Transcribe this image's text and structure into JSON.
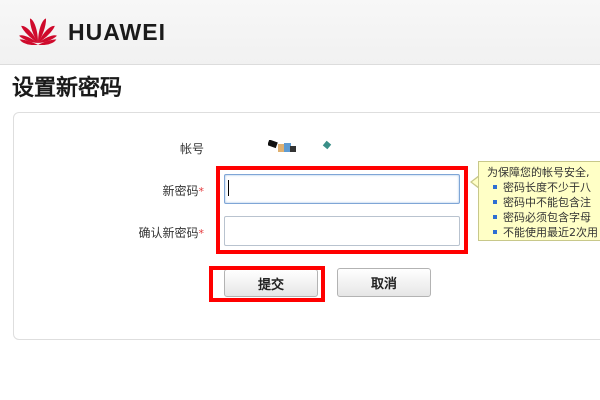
{
  "header": {
    "brand_name": "HUAWEI",
    "brand_color": "#cf0a2c"
  },
  "page": {
    "title": "设置新密码"
  },
  "form": {
    "account_label": "帐号",
    "new_password_label": "新密码",
    "confirm_password_label": "确认新密码",
    "required_mark": "*",
    "new_password_value": "",
    "confirm_password_value": "",
    "submit_label": "提交",
    "cancel_label": "取消"
  },
  "tooltip": {
    "title": "为保障您的帐号安全,",
    "rules": [
      "密码长度不少于八",
      "密码中不能包含注",
      "密码必须包含字母",
      "不能使用最近2次用"
    ]
  },
  "colors": {
    "highlight": "#ff0000",
    "tooltip_bg": "#ffffc6",
    "required": "#e4393c"
  }
}
